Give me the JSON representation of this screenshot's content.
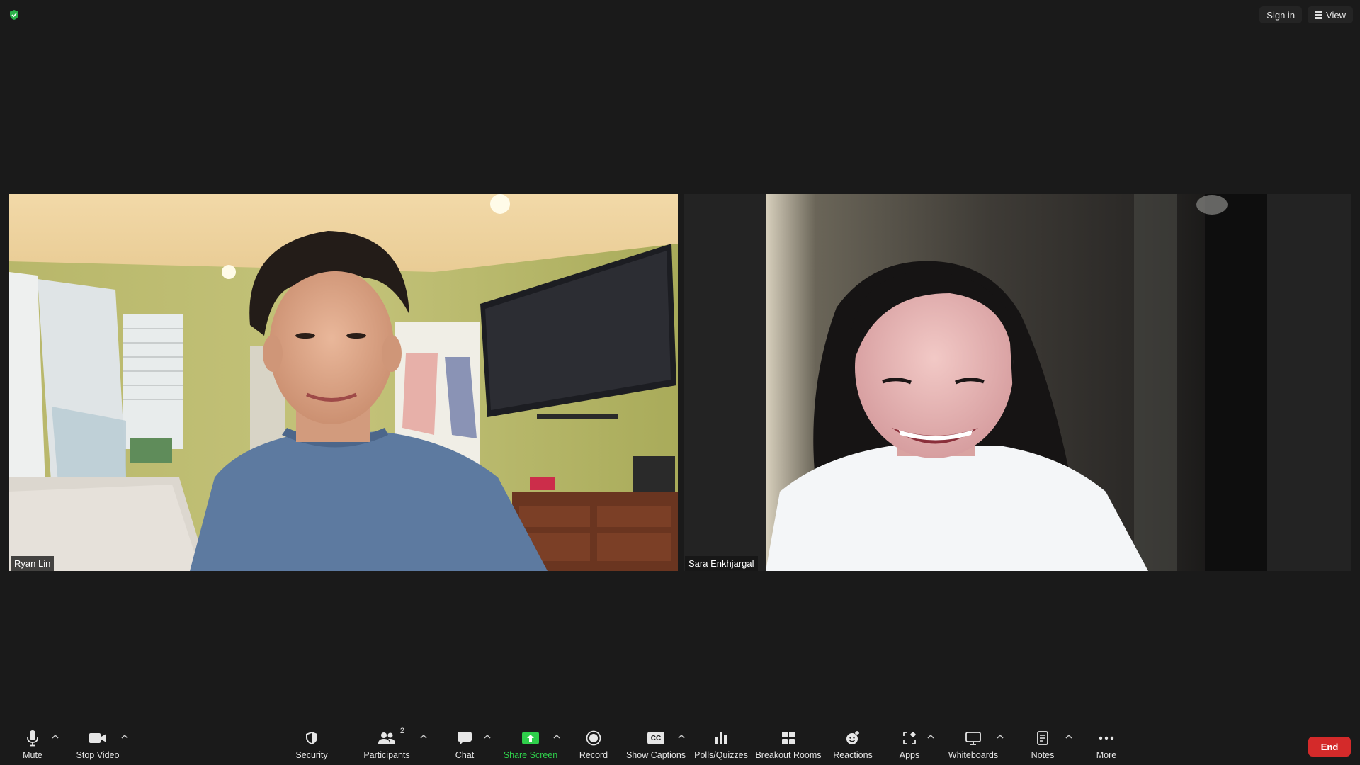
{
  "topbar": {
    "sign_in_label": "Sign in",
    "view_label": "View"
  },
  "participants": [
    {
      "name": "Ryan Lin"
    },
    {
      "name": "Sara Enkhjargal"
    }
  ],
  "toolbar": {
    "mute_label": "Mute",
    "stop_video_label": "Stop Video",
    "security_label": "Security",
    "participants_label": "Participants",
    "participants_count": "2",
    "chat_label": "Chat",
    "share_screen_label": "Share Screen",
    "record_label": "Record",
    "show_captions_label": "Show Captions",
    "captions_icon_text": "CC",
    "polls_label": "Polls/Quizzes",
    "breakout_label": "Breakout Rooms",
    "reactions_label": "Reactions",
    "apps_label": "Apps",
    "whiteboards_label": "Whiteboards",
    "notes_label": "Notes",
    "more_label": "More",
    "end_label": "End"
  },
  "colors": {
    "background": "#1a1a1a",
    "share_green": "#2fcf4b",
    "end_red": "#d42a2a",
    "security_shield": "#2bb34a"
  }
}
